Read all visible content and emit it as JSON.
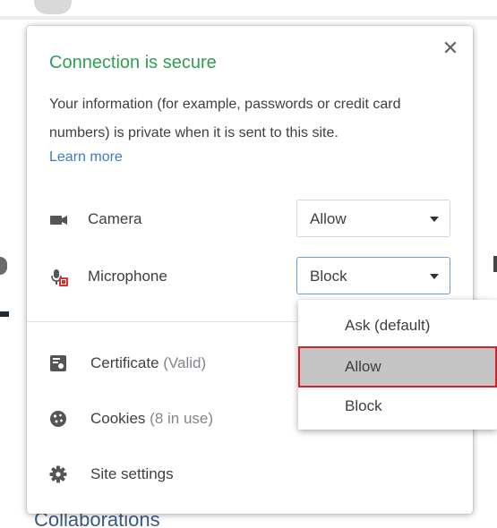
{
  "popup": {
    "title": "Connection is secure",
    "description": "Your information (for example, passwords or credit card numbers) is private when it is sent to this site.",
    "learn_more": "Learn more",
    "close_glyph": "✕"
  },
  "permissions": [
    {
      "label": "Camera",
      "value": "Allow",
      "icon": "camera-icon"
    },
    {
      "label": "Microphone",
      "value": "Block",
      "icon": "microphone-blocked-icon"
    }
  ],
  "links": {
    "certificate": {
      "label": "Certificate",
      "sub": "(Valid)",
      "icon": "certificate-icon"
    },
    "cookies": {
      "label": "Cookies",
      "sub": "(8 in use)",
      "icon": "cookie-icon"
    },
    "site_settings": {
      "label": "Site settings",
      "icon": "gear-icon"
    }
  },
  "dropdown": {
    "options": [
      "Ask (default)",
      "Allow",
      "Block"
    ],
    "hovered": "Allow"
  },
  "background": {
    "bottom_text": "Collaborations"
  },
  "colors": {
    "secure_green": "#2f9e55",
    "link_blue": "#3b78c8",
    "highlight_red": "#d1232a"
  }
}
